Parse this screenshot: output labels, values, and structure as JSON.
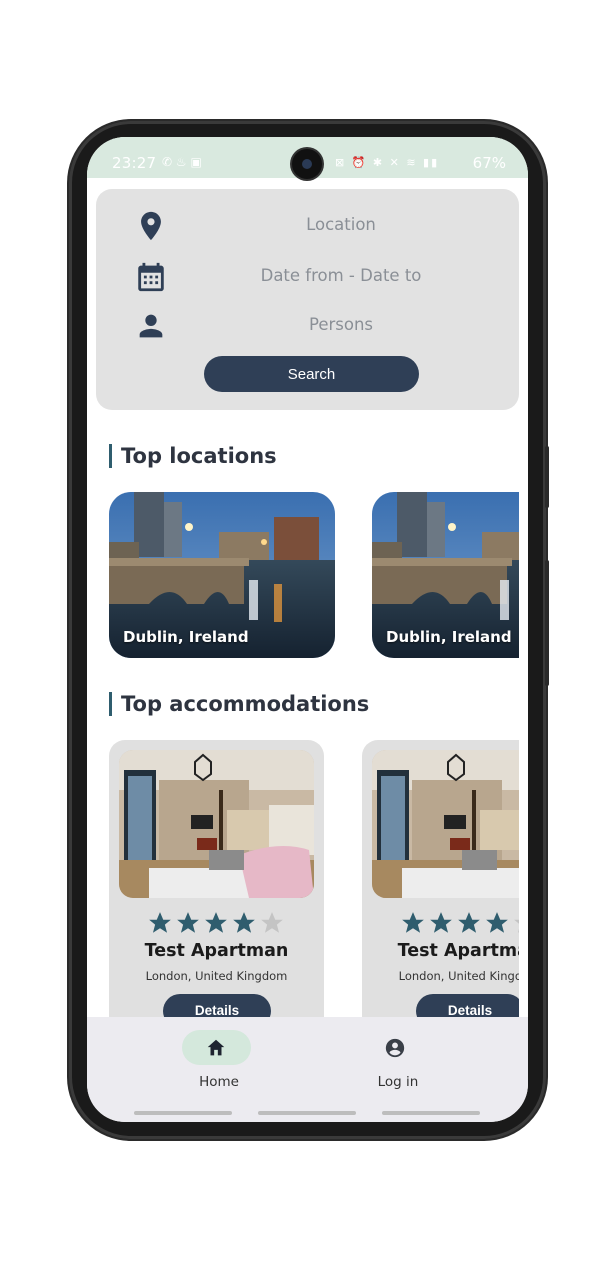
{
  "status_bar": {
    "time": "23:27",
    "left_icons": "✆ ♨ ▣",
    "right_icons": "⊠ ⏰ ✱ ✕ ≋ ▮▮",
    "battery": "67%"
  },
  "search": {
    "location_placeholder": "Location",
    "date_placeholder": "Date from - Date to",
    "persons_placeholder": "Persons",
    "button_label": "Search",
    "icons": [
      "location-pin-icon",
      "calendar-icon",
      "person-icon"
    ]
  },
  "top_locations": {
    "title": "Top locations",
    "items": [
      {
        "label": "Dublin, Ireland"
      },
      {
        "label": "Dublin, Ireland"
      }
    ]
  },
  "top_accommodations": {
    "title": "Top accommodations",
    "items": [
      {
        "name": "Test Apartman",
        "location": "London, United Kingdom",
        "rating": 4,
        "max_rating": 5,
        "button": "Details"
      },
      {
        "name": "Test Apartman",
        "location": "London, United Kingdom",
        "rating": 4,
        "max_rating": 5,
        "button": "Details"
      }
    ]
  },
  "bottom_nav": {
    "items": [
      {
        "label": "Home",
        "icon": "home-icon",
        "active": true
      },
      {
        "label": "Log in",
        "icon": "account-circle-icon",
        "active": false
      }
    ]
  },
  "colors": {
    "primary": "#2f3f56",
    "star_filled": "#2f5d6e",
    "star_empty": "#c4c4c4",
    "status_bar": "#d9e9df",
    "nav_active": "#d4e8dc"
  }
}
